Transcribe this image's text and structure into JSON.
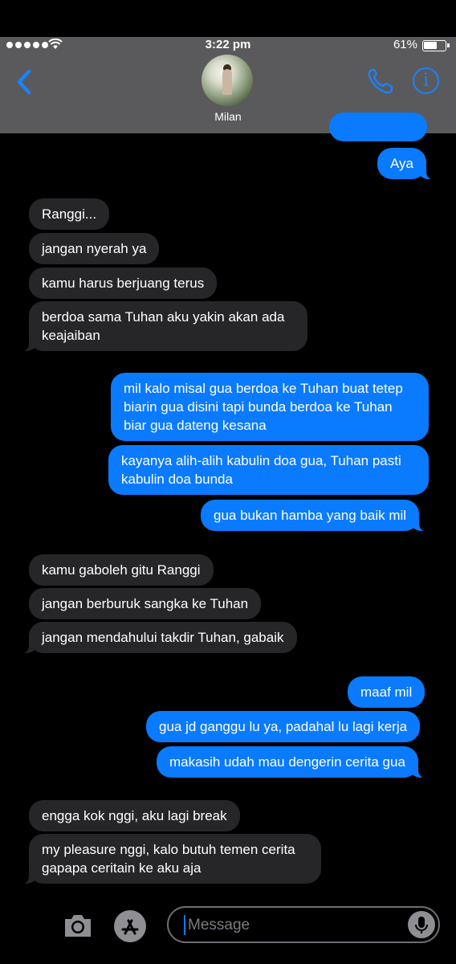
{
  "status": {
    "time": "3:22 pm",
    "battery": "61%"
  },
  "header": {
    "contact_name": "Milan",
    "back_icon": "chevron-left-icon",
    "call_icon": "phone-icon",
    "info_icon": "info-icon"
  },
  "messages": [
    {
      "dir": "out",
      "text": "Aya"
    },
    {
      "dir": "in",
      "text": "Ranggi..."
    },
    {
      "dir": "in",
      "text": "jangan nyerah ya"
    },
    {
      "dir": "in",
      "text": "kamu harus berjuang terus"
    },
    {
      "dir": "in",
      "text": "berdoa sama Tuhan aku yakin akan ada keajaiban"
    },
    {
      "dir": "out",
      "text": "mil kalo misal gua berdoa ke Tuhan buat tetep biarin gua disini tapi bunda berdoa ke Tuhan biar gua dateng kesana"
    },
    {
      "dir": "out",
      "text": "kayanya alih-alih kabulin doa gua, Tuhan pasti kabulin doa bunda"
    },
    {
      "dir": "out",
      "text": "gua bukan hamba yang baik mil"
    },
    {
      "dir": "in",
      "text": "kamu gaboleh gitu Ranggi"
    },
    {
      "dir": "in",
      "text": "jangan berburuk sangka ke Tuhan"
    },
    {
      "dir": "in",
      "text": "jangan mendahului takdir Tuhan, gabaik"
    },
    {
      "dir": "out",
      "text": "maaf mil"
    },
    {
      "dir": "out",
      "text": "gua jd ganggu lu ya, padahal lu lagi kerja"
    },
    {
      "dir": "out",
      "text": "makasih udah mau dengerin cerita gua"
    },
    {
      "dir": "in",
      "text": "engga kok nggi, aku lagi break"
    },
    {
      "dir": "in",
      "text": "my pleasure nggi, kalo butuh temen cerita gapapa ceritain ke aku aja"
    }
  ],
  "composer": {
    "placeholder": "Message",
    "camera_icon": "camera-icon",
    "apps_icon": "app-store-icon",
    "mic_icon": "microphone-icon"
  },
  "colors": {
    "outgoing": "#0a7aff",
    "incoming": "#262628",
    "header": "#5a5a5c",
    "accent": "#1a82ff"
  }
}
